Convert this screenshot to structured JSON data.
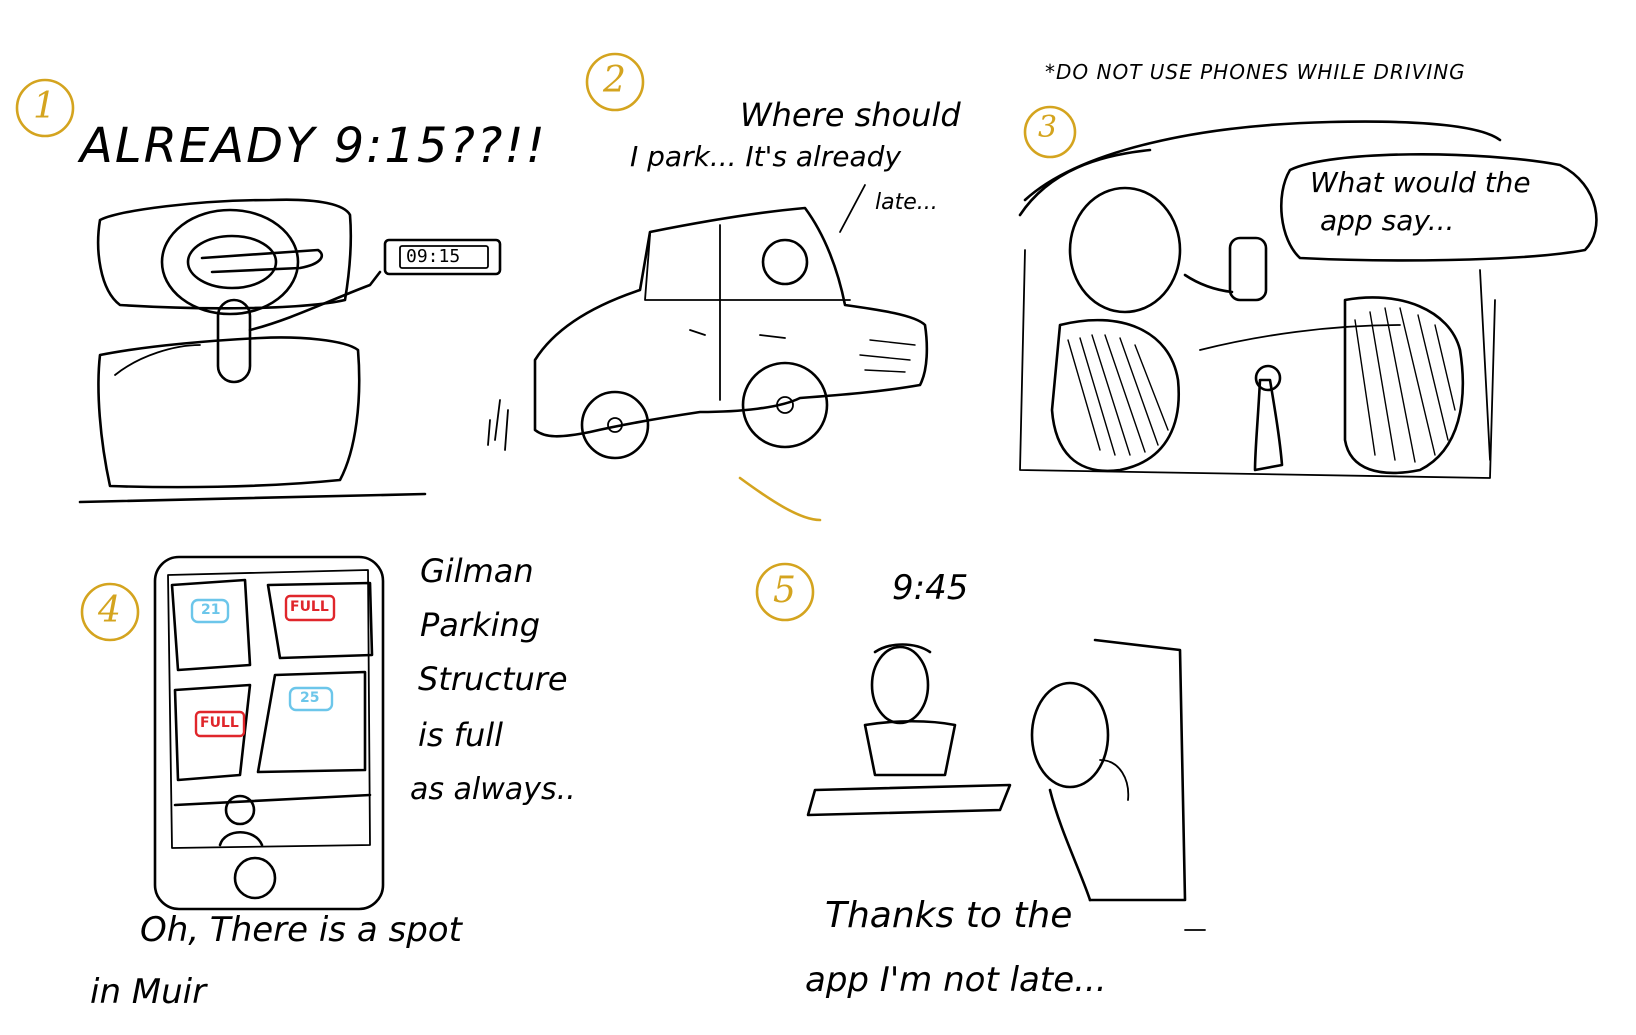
{
  "colors": {
    "ink": "#000000",
    "panel_number": "#d4a41f",
    "full_badge": "#e0262b",
    "open_badge": "#6cc6ea"
  },
  "panels": [
    {
      "number": "1",
      "caption": "ALREADY 9:15??!!",
      "clock_display": "09:15"
    },
    {
      "number": "2",
      "speech_line1": "Where should",
      "speech_line2": "I park... It's already",
      "speech_line3": "late..."
    },
    {
      "number": "3",
      "warning": "*DO NOT USE PHONES WHILE DRIVING",
      "speech_line1": "What would the",
      "speech_line2": "app say..."
    },
    {
      "number": "4",
      "badges": [
        "21",
        "FULL",
        "FULL",
        "25"
      ],
      "side_line1": "Gilman",
      "side_line2": "Parking",
      "side_line3": "Structure",
      "side_line4": "is full",
      "side_line5": "as always..",
      "bottom_line1": "Oh, There is a spot",
      "bottom_line2": "in Muir"
    },
    {
      "number": "5",
      "time": "9:45",
      "caption_line1": "Thanks to the",
      "caption_line2": "app I'm not late..."
    }
  ]
}
